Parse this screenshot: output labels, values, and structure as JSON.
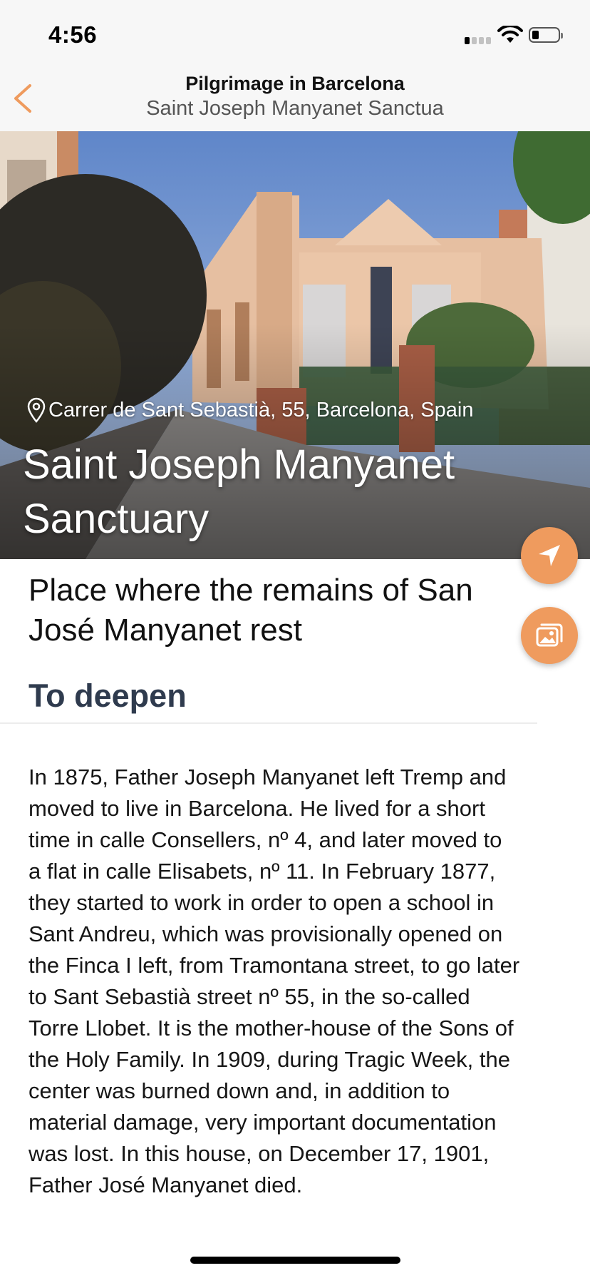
{
  "status_bar": {
    "time": "4:56",
    "icons": [
      "cellular-signal-icon",
      "wifi-icon",
      "battery-icon"
    ]
  },
  "nav": {
    "back_icon": "chevron-left-icon",
    "title": "Pilgrimage in Barcelona",
    "subtitle": "Saint Joseph Manyanet Sanctua"
  },
  "hero": {
    "address_icon": "map-pin-icon",
    "address": "Carrer de Sant Sebastià, 55, Barcelona, Spain",
    "title": "Saint Joseph Manyanet Sanctuary"
  },
  "actions": {
    "navigate_icon": "navigation-arrow-icon",
    "gallery_icon": "photo-gallery-icon"
  },
  "content": {
    "subtitle": "Place where the remains of San José Manyanet rest",
    "section_heading": "To deepen",
    "body": "In 1875, Father Joseph Manyanet left Tremp and moved to live in Barcelona. He lived for a short time in calle Consellers, nº 4, and later moved to a flat in calle Elisabets, nº 11. In February 1877, they started to work in order to open a school in Sant Andreu, which was provisionally opened on the Finca I left, from Tramontana street, to go later to Sant Sebastià street nº 55, in the so-called Torre Llobet. It is the mother-house of the Sons of the Holy Family. In 1909, during Tragic Week, the center was burned down and, in addition to material damage, very important documentation was lost. In this house, on December 17, 1901, Father José Manyanet died."
  },
  "colors": {
    "accent": "#ef9b5e",
    "heading": "#2f3b4e",
    "bar_background": "#f7f7f7"
  }
}
